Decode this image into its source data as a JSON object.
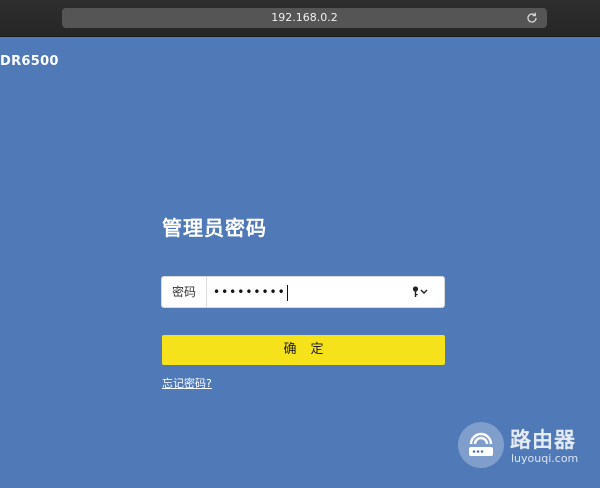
{
  "browser": {
    "url": "192.168.0.2"
  },
  "brand": {
    "model": "DR6500"
  },
  "login": {
    "title": "管理员密码",
    "password_label": "密码",
    "password_value": "•••••••••",
    "confirm_label": "确定",
    "forgot_link": "忘记密码?"
  },
  "watermark": {
    "title": "路由器",
    "subtitle": "luyouqi.com"
  },
  "colors": {
    "background": "#5079b8",
    "confirm_button": "#f6e21a"
  }
}
